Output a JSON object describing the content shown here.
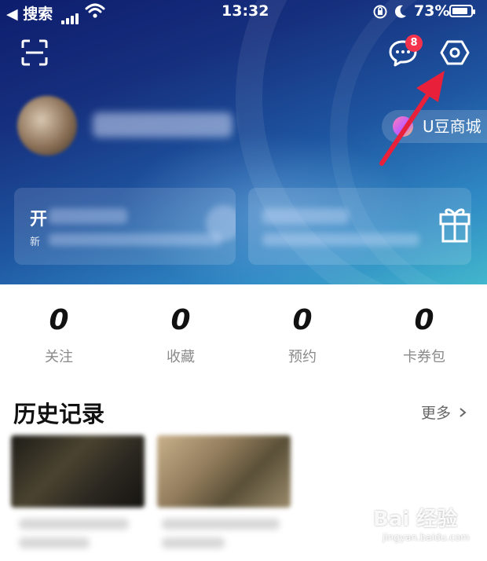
{
  "status_bar": {
    "back_label": "◀ 搜索",
    "time": "13:32",
    "battery_percent": "73%",
    "battery_level": 0.73,
    "icons": [
      "signal-icon",
      "wifi-icon",
      "orientation-lock-icon",
      "moon-icon",
      "battery-icon"
    ]
  },
  "toolbar": {
    "scan_icon": "scan-icon",
    "message_icon": "chat-bubble-icon",
    "message_badge": "8",
    "settings_icon": "hexagon-settings-icon"
  },
  "profile": {
    "mall_label": "U豆商城"
  },
  "cards": [
    {
      "title_fragment": "开",
      "subtitle_fragment": "新"
    },
    {
      "icon": "gift-icon"
    }
  ],
  "stats": [
    {
      "value": "0",
      "label": "关注"
    },
    {
      "value": "0",
      "label": "收藏"
    },
    {
      "value": "0",
      "label": "预约"
    },
    {
      "value": "0",
      "label": "卡券包"
    }
  ],
  "history": {
    "title": "历史记录",
    "more_label": "更多"
  },
  "watermark": {
    "brand": "Bai 经验",
    "url": "jingyan.baidu.com"
  },
  "colors": {
    "header_dark": "#0e1d6e",
    "header_light": "#42b7cc",
    "badge": "#f5334d",
    "arrow": "#e8203a"
  }
}
